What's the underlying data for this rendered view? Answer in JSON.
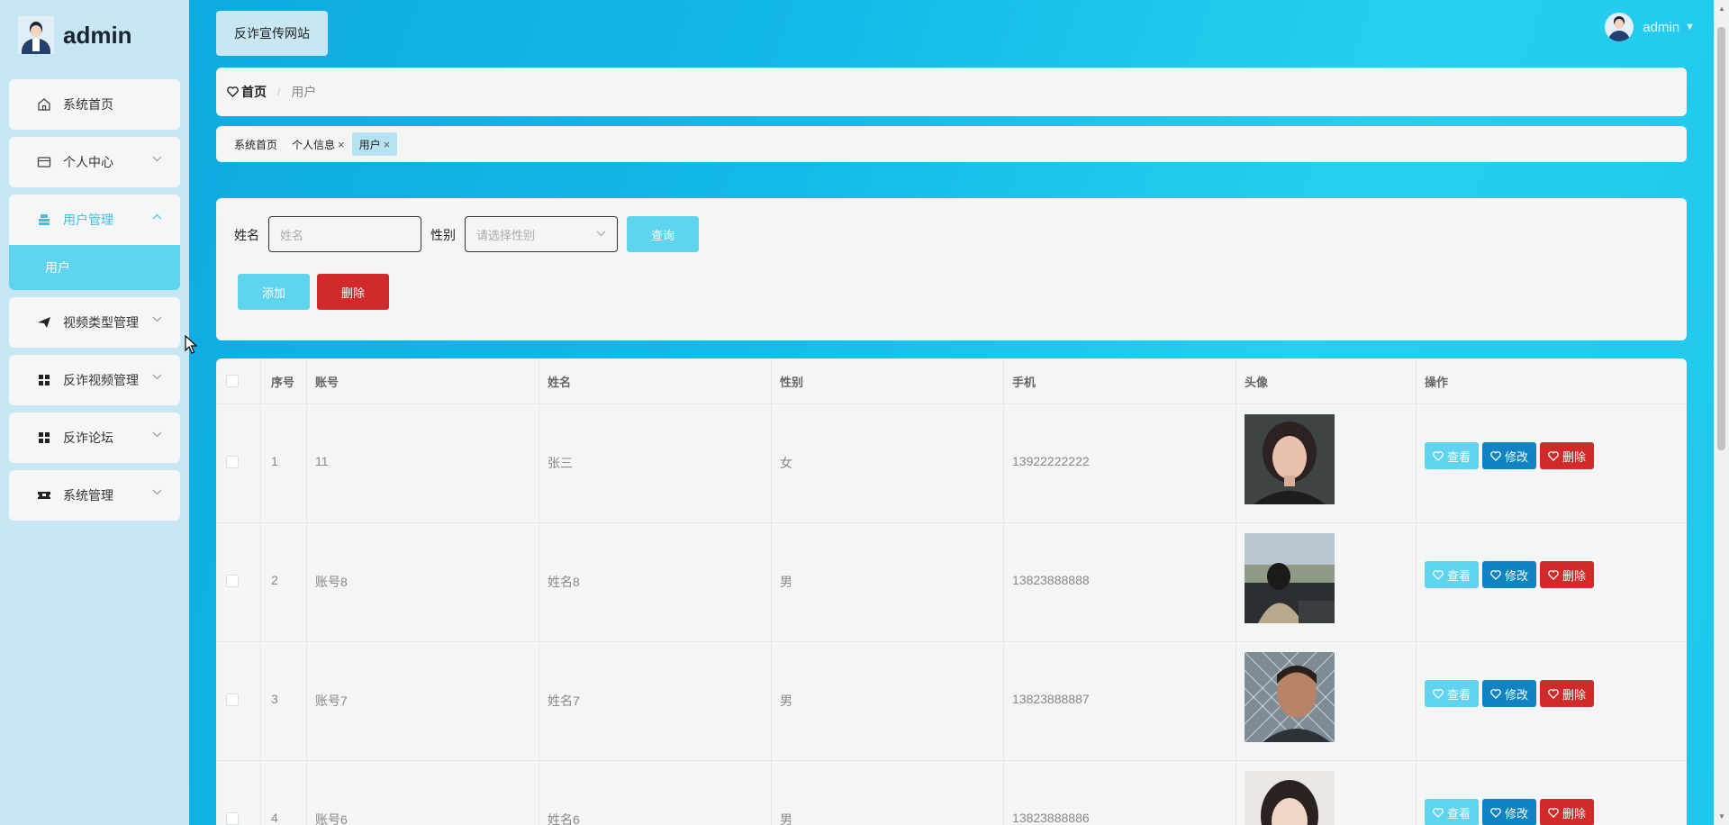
{
  "brand": {
    "name": "admin"
  },
  "sidebar": {
    "items": [
      {
        "label": "系统首页",
        "icon": "home-icon"
      },
      {
        "label": "个人中心",
        "icon": "card-icon"
      },
      {
        "label": "用户管理",
        "icon": "user-group-icon"
      },
      {
        "label": "视频类型管理",
        "icon": "paper-plane-icon"
      },
      {
        "label": "反诈视频管理",
        "icon": "grid-icon"
      },
      {
        "label": "反诈论坛",
        "icon": "grid-icon"
      },
      {
        "label": "系统管理",
        "icon": "ticket-icon"
      }
    ],
    "sub_item": "用户",
    "accent_color": "#3ec2e3"
  },
  "header": {
    "site_button": "反诈宣传网站",
    "user": "admin"
  },
  "breadcrumb": {
    "home": "首页",
    "sep": "/",
    "current": "用户"
  },
  "tags": [
    {
      "label": "系统首页",
      "closable": false
    },
    {
      "label": "个人信息",
      "closable": true
    },
    {
      "label": "用户",
      "closable": true,
      "active": true
    }
  ],
  "tag_close": "×",
  "search": {
    "name_label": "姓名",
    "name_placeholder": "姓名",
    "gender_label": "性别",
    "gender_placeholder": "请选择性别",
    "query_button": "查询",
    "add_button": "添加",
    "delete_button": "删除"
  },
  "table": {
    "headers": [
      "序号",
      "账号",
      "姓名",
      "性别",
      "手机",
      "头像",
      "操作"
    ],
    "rows": [
      {
        "index": "1",
        "account": "11",
        "name": "张三",
        "gender": "女",
        "phone": "13922222222",
        "photo": "photo-woman-dark-background"
      },
      {
        "index": "2",
        "account": "账号8",
        "name": "姓名8",
        "gender": "男",
        "phone": "13823888888",
        "photo": "photo-man-on-rooftop"
      },
      {
        "index": "3",
        "account": "账号7",
        "name": "姓名7",
        "gender": "男",
        "phone": "13823888887",
        "photo": "photo-man-chain-fence"
      },
      {
        "index": "4",
        "account": "账号6",
        "name": "姓名6",
        "gender": "男",
        "phone": "13823888886",
        "photo": "photo-woman-light"
      }
    ],
    "actions": {
      "view": "查看",
      "edit": "修改",
      "delete": "删除"
    }
  },
  "colors": {
    "cyan": "#5ed4ee",
    "blue": "#1084c2",
    "red": "#d22a2a"
  }
}
